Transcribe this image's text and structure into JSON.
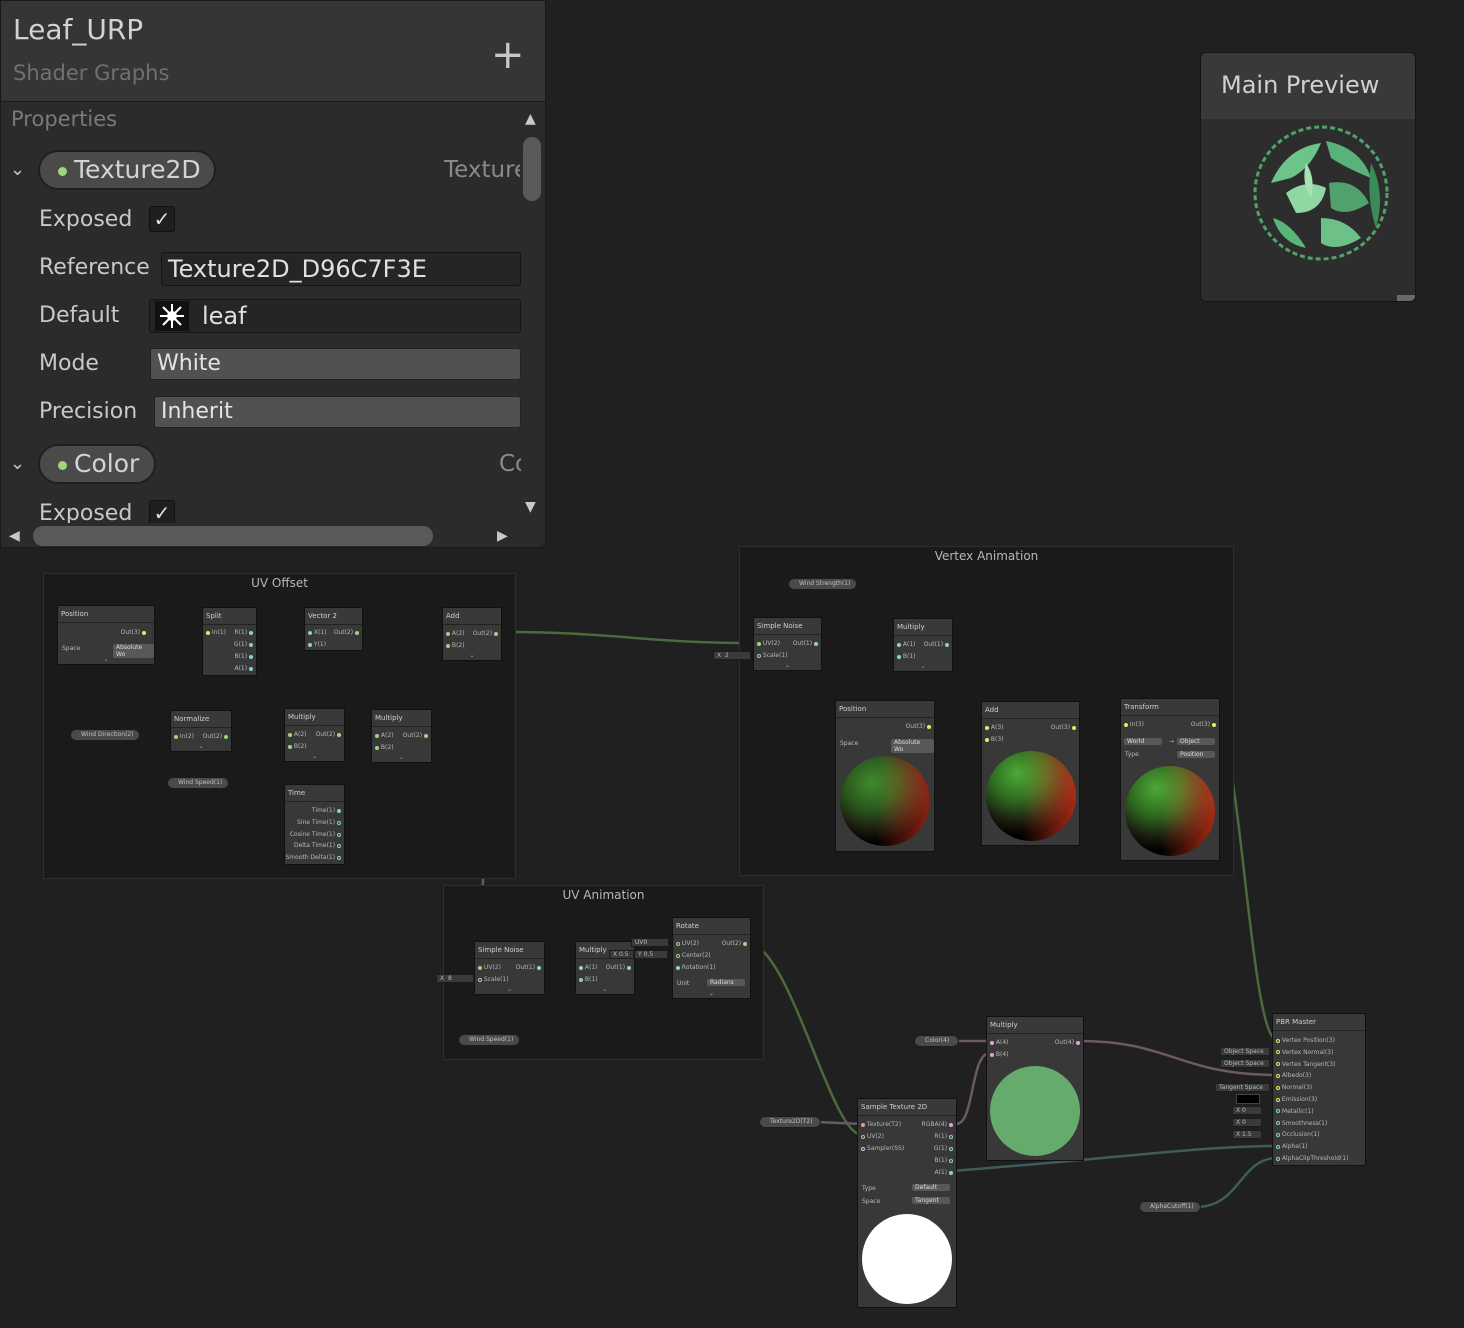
{
  "colors": {
    "accent_green": "#9ed67c",
    "wire_green": "#4c6b3c",
    "wire_teal": "#3f5c5c",
    "wire_mauve": "#6a5a62"
  },
  "blackboard": {
    "title": "Leaf_URP",
    "subtitle": "Shader Graphs",
    "add_label": "+",
    "section_label": "Properties",
    "properties": [
      {
        "name": "Texture2D",
        "type": "Texture",
        "exposed_label": "Exposed",
        "exposed": "✓",
        "reference_label": "Reference",
        "reference": "Texture2D_D96C7F3E",
        "default_label": "Default",
        "default": "leaf",
        "mode_label": "Mode",
        "mode": "White",
        "precision_label": "Precision",
        "precision": "Inherit"
      },
      {
        "name": "Color",
        "type": "Co",
        "exposed_label": "Exposed",
        "exposed": "✓"
      }
    ],
    "chevron": "⌄",
    "scroll_up": "▲",
    "scroll_down": "▼",
    "scroll_left": "◀",
    "scroll_right": "▶"
  },
  "preview": {
    "title": "Main Preview"
  },
  "groups": {
    "uv_offset": "UV Offset",
    "vertex_animation": "Vertex Animation",
    "uv_animation": "UV Animation"
  },
  "nodes": {
    "position1": {
      "title": "Position",
      "out": "Out(3)",
      "space_label": "Space",
      "space": "Absolute Wo"
    },
    "split": {
      "title": "Split",
      "in": "In(1)",
      "outs": [
        "R(1)",
        "G(1)",
        "B(1)",
        "A(1)"
      ]
    },
    "vector2": {
      "title": "Vector 2",
      "ins": [
        "X(1)",
        "Y(1)"
      ],
      "out": "Out(2)"
    },
    "add1": {
      "title": "Add",
      "ins": [
        "A(2)",
        "B(2)"
      ],
      "out": "Out(2)"
    },
    "normalize": {
      "title": "Normalize",
      "in": "In(2)",
      "out": "Out(2)"
    },
    "multiply1": {
      "title": "Multiply",
      "ins": [
        "A(2)",
        "B(2)"
      ],
      "out": "Out(2)"
    },
    "multiply2": {
      "title": "Multiply",
      "ins": [
        "A(2)",
        "B(2)"
      ],
      "out": "Out(2)"
    },
    "time": {
      "title": "Time",
      "outs": [
        "Time(1)",
        "Sine Time(1)",
        "Cosine Time(1)",
        "Delta Time(1)",
        "Smooth Delta(1)"
      ]
    },
    "wind_direction": "Wind Direction(2)",
    "wind_speed1": "Wind Speed(1)",
    "wind_strength": "Wind Strength(1)",
    "simple_noise1": {
      "title": "Simple Noise",
      "ins": [
        "UV(2)",
        "Scale(1)"
      ],
      "out": "Out(1)",
      "scale_x": "X",
      "scale_val": "2"
    },
    "multiply3": {
      "title": "Multiply",
      "ins": [
        "A(1)",
        "B(1)"
      ],
      "out": "Out(1)"
    },
    "position2": {
      "title": "Position",
      "out": "Out(3)",
      "space_label": "Space",
      "space": "Absolute Wo"
    },
    "add2": {
      "title": "Add",
      "ins": [
        "A(3)",
        "B(3)"
      ],
      "out": "Out(3)"
    },
    "transform": {
      "title": "Transform",
      "in": "In(3)",
      "out": "Out(3)",
      "from": "World",
      "to": "Object",
      "type_label": "Type",
      "type": "Position",
      "arrow": "→"
    },
    "simple_noise2": {
      "title": "Simple Noise",
      "ins": [
        "UV(2)",
        "Scale(1)"
      ],
      "out": "Out(1)",
      "scale_x": "X",
      "scale_val": "8"
    },
    "multiply4": {
      "title": "Multiply",
      "ins": [
        "A(1)",
        "B(1)"
      ],
      "out": "Out(1)"
    },
    "rotate": {
      "title": "Rotate",
      "ins": [
        "UV(2)",
        "Center(2)",
        "Rotation(1)"
      ],
      "out": "Out(2)",
      "uv": "UV0",
      "cx": "X",
      "cxv": "0.5",
      "cy": "Y",
      "cyv": "0.5",
      "unit_label": "Unit",
      "unit": "Radians"
    },
    "wind_speed2": "Wind Speed(1)",
    "color_prop": "Color(4)",
    "multiply5": {
      "title": "Multiply",
      "ins": [
        "A(4)",
        "B(4)"
      ],
      "out": "Out(4)"
    },
    "texture_prop": "Texture2D(T2)",
    "sample_tex": {
      "title": "Sample Texture 2D",
      "ins": [
        "Texture(T2)",
        "UV(2)",
        "Sampler(SS)"
      ],
      "outs": [
        "RGBA(4)",
        "R(1)",
        "G(1)",
        "B(1)",
        "A(1)"
      ],
      "type_label": "Type",
      "type": "Default",
      "space_label": "Space",
      "space": "Tangent"
    },
    "alpha_cutoff": "AlphaCutoff(1)",
    "pbr": {
      "title": "PBR Master",
      "ins": [
        "Vertex Position(3)",
        "Vertex Normal(3)",
        "Vertex Tangent(3)",
        "Albedo(3)",
        "Normal(3)",
        "Emission(3)",
        "Metallic(1)",
        "Smoothness(1)",
        "Occlusion(1)",
        "Alpha(1)",
        "AlphaClipThreshold(1)"
      ],
      "defaults": {
        "normal_space": "Object Space",
        "tangent_space": "Object Space",
        "normal_ts": "Tangent Space",
        "metallic_x": "X",
        "metallic": "0",
        "smooth_x": "X",
        "smooth": "0",
        "occl_x": "X",
        "occl": "1.5"
      }
    }
  }
}
